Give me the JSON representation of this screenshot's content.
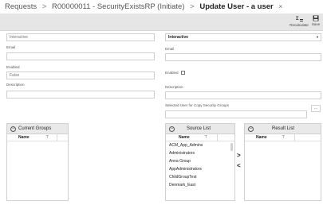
{
  "header": {
    "crumb_requests": "Requests",
    "sep1": ">",
    "crumb_request": "R00000011 - SecurityExistsRP (Initiate)",
    "sep2": ">",
    "current": "Update User - a user",
    "close_glyph": "×"
  },
  "toolbar": {
    "recalculate_label": "Recalculate",
    "save_label": "Save"
  },
  "left_form": {
    "user_value": "Interactive",
    "email_label": "Email",
    "email_value": "",
    "enabled_label": "Enabled",
    "enabled_value": "False",
    "description_label": "Description",
    "description_value": ""
  },
  "right_form": {
    "user_select_value": "Interactive",
    "email_label": "Email",
    "email_value": "",
    "enabled_label": "Enabled",
    "enabled_checked": false,
    "description_label": "Description",
    "description_value": "",
    "copy_groups_label": "Selected User for Copy Security Groups",
    "copy_groups_value": "",
    "dots_label": "..."
  },
  "panels": {
    "current_groups": {
      "title": "Current Groups",
      "column": "Name",
      "items": []
    },
    "source_list": {
      "title": "Source List",
      "column": "Name",
      "items": [
        "ACM_App_Admins",
        "Administrators",
        "Anna Group",
        "AppAdministrators",
        "ChildGroupTest",
        "Denmark_East"
      ]
    },
    "result_list": {
      "title": "Result List",
      "column": "Name",
      "items": []
    }
  },
  "transfer": {
    "add_glyph": ">",
    "remove_glyph": "<"
  },
  "icons": {
    "recalculate": "recalculate-icon",
    "save": "save-icon",
    "filter": "filter-icon",
    "collapse": "collapse-icon",
    "dropdown": "chevron-down-icon"
  }
}
